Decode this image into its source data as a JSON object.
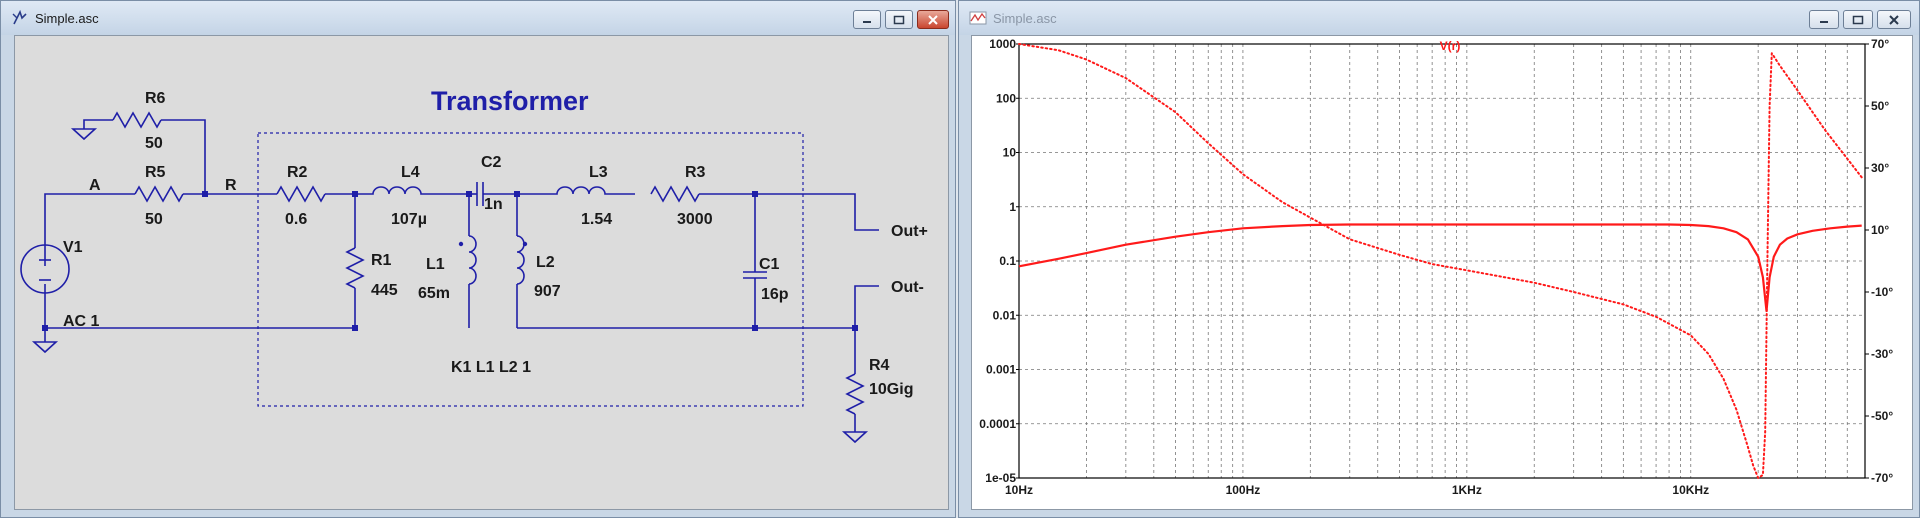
{
  "schematic_window": {
    "title": "Simple.asc",
    "heading": "Transformer",
    "components": [
      {
        "ref": "R6",
        "value": "50"
      },
      {
        "ref": "R5",
        "value": "50"
      },
      {
        "ref": "R2",
        "value": "0.6"
      },
      {
        "ref": "L4",
        "value": "107µ"
      },
      {
        "ref": "C2",
        "value": "1n"
      },
      {
        "ref": "L3",
        "value": "1.54"
      },
      {
        "ref": "R3",
        "value": "3000"
      },
      {
        "ref": "R1",
        "value": "445"
      },
      {
        "ref": "L1",
        "value": "65m"
      },
      {
        "ref": "L2",
        "value": "907"
      },
      {
        "ref": "C1",
        "value": "16p"
      },
      {
        "ref": "R4",
        "value": "10Gig"
      },
      {
        "ref": "V1",
        "value": "AC 1"
      }
    ],
    "nets": {
      "a": "A",
      "r": "R",
      "out_plus": "Out+",
      "out_minus": "Out-"
    },
    "directive": "K1 L1 L2 1"
  },
  "waveform_window": {
    "title": "Simple.asc",
    "trace_name": "V(r)"
  },
  "colors": {
    "schematic_ink": "#1f1fa8",
    "trace": "#ff1a1a",
    "node": "#1f1fa8"
  },
  "chart_data": {
    "type": "line",
    "title": "V(r)",
    "x_scale": "log",
    "xlim": [
      10,
      60000
    ],
    "x_ticks": [
      "10Hz",
      "100Hz",
      "1KHz",
      "10KHz"
    ],
    "y_scale": "log",
    "ylim": [
      1e-05,
      1000
    ],
    "y_ticks": [
      "1000",
      "100",
      "10",
      "1",
      "0.1",
      "0.01",
      "0.001",
      "0.0001",
      "1e-05"
    ],
    "y2lim": [
      -70,
      70
    ],
    "y2_ticks": [
      "70°",
      "50°",
      "30°",
      "10°",
      "-10°",
      "-30°",
      "-50°",
      "-70°"
    ],
    "grid": true,
    "series": [
      {
        "role": "magnitude",
        "style": "solid",
        "x": [
          10,
          15,
          20,
          30,
          50,
          70,
          100,
          150,
          200,
          300,
          500,
          1000,
          2000,
          5000,
          8000,
          10000,
          12000,
          14000,
          16000,
          18000,
          20000,
          21000,
          21800,
          22500,
          23500,
          25000,
          27000,
          30000,
          35000,
          42000,
          50000,
          58000
        ],
        "y": [
          0.08,
          0.11,
          0.14,
          0.2,
          0.28,
          0.34,
          0.4,
          0.44,
          0.46,
          0.47,
          0.47,
          0.47,
          0.47,
          0.47,
          0.47,
          0.46,
          0.44,
          0.4,
          0.34,
          0.25,
          0.12,
          0.05,
          0.012,
          0.05,
          0.12,
          0.2,
          0.26,
          0.31,
          0.36,
          0.4,
          0.43,
          0.45
        ]
      },
      {
        "role": "phase",
        "style": "dotted",
        "x": [
          10,
          15,
          20,
          30,
          50,
          70,
          100,
          150,
          200,
          300,
          500,
          700,
          1000,
          2000,
          3000,
          5000,
          7000,
          10000,
          12000,
          14000,
          16000,
          18000,
          19000,
          20000,
          21000,
          21500,
          22000,
          22500,
          23000,
          25000,
          30000,
          35000,
          40000,
          50000,
          58000
        ],
        "y": [
          70,
          68,
          65,
          59,
          48,
          38,
          28,
          19,
          14,
          7,
          2,
          -1,
          -3,
          -7,
          -10,
          -14,
          -18,
          -24,
          -30,
          -38,
          -48,
          -60,
          -66,
          -70,
          -69,
          -55,
          0,
          50,
          67,
          63,
          55,
          48,
          42,
          33,
          27
        ]
      }
    ]
  }
}
